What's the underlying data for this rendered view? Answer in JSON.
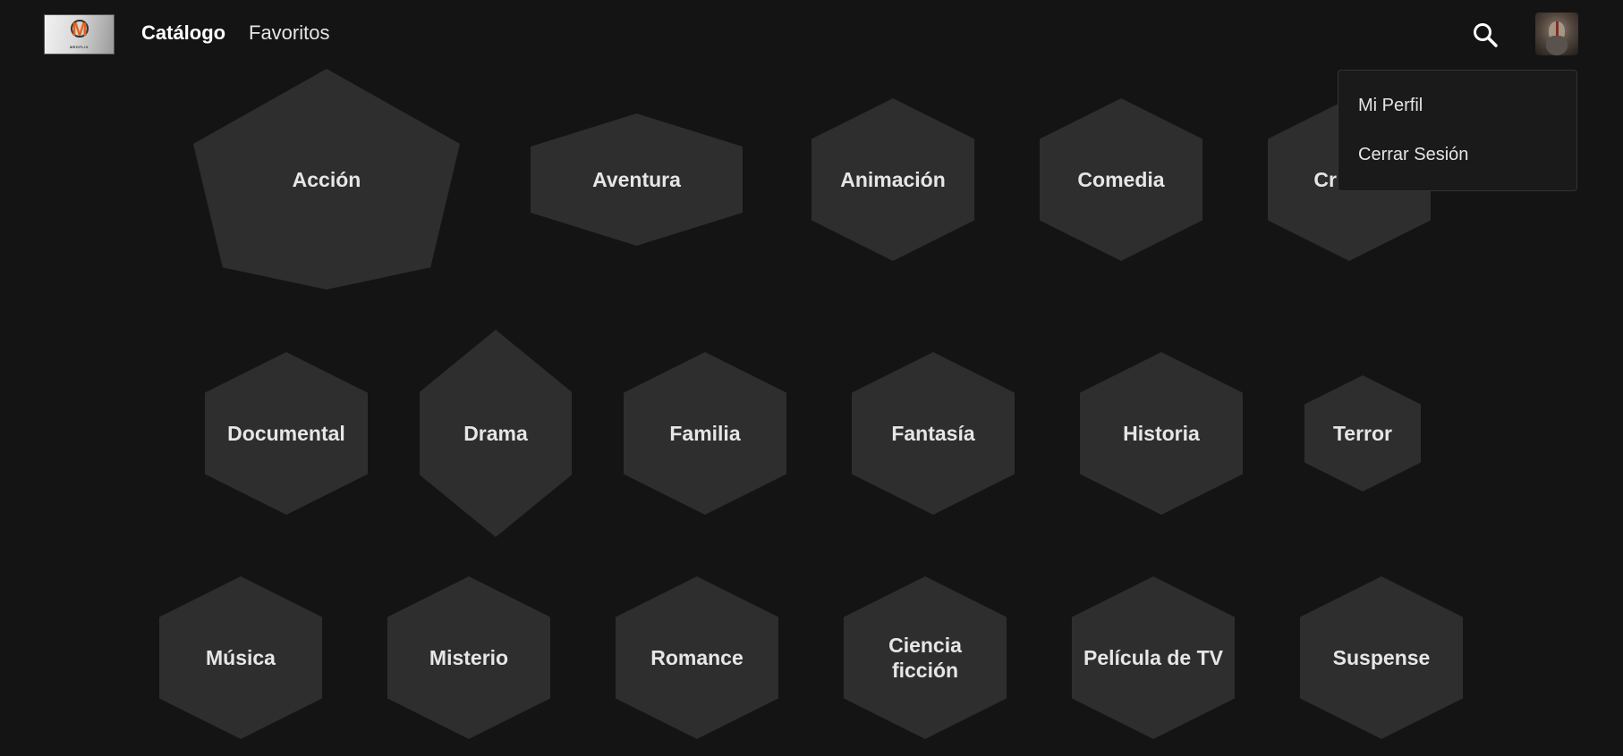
{
  "header": {
    "logo_text": "M",
    "logo_word": "MEDFLIX",
    "nav": [
      {
        "label": "Catálogo"
      },
      {
        "label": "Favoritos"
      }
    ]
  },
  "profile_menu": {
    "items": [
      {
        "label": "Mi Perfil"
      },
      {
        "label": "Cerrar Sesión"
      }
    ]
  },
  "genres": [
    {
      "label": "Acción"
    },
    {
      "label": "Aventura"
    },
    {
      "label": "Animación"
    },
    {
      "label": "Comedia"
    },
    {
      "label": "Crimen"
    },
    {
      "label": "Documental"
    },
    {
      "label": "Drama"
    },
    {
      "label": "Familia"
    },
    {
      "label": "Fantasía"
    },
    {
      "label": "Historia"
    },
    {
      "label": "Terror"
    },
    {
      "label": "Música"
    },
    {
      "label": "Misterio"
    },
    {
      "label": "Romance"
    },
    {
      "label": "Ciencia ficción"
    },
    {
      "label": "Película de TV"
    },
    {
      "label": "Suspense"
    }
  ],
  "colors": {
    "background": "#141414",
    "tile": "#2e2e2e",
    "logo_accent": "#e8611a"
  }
}
